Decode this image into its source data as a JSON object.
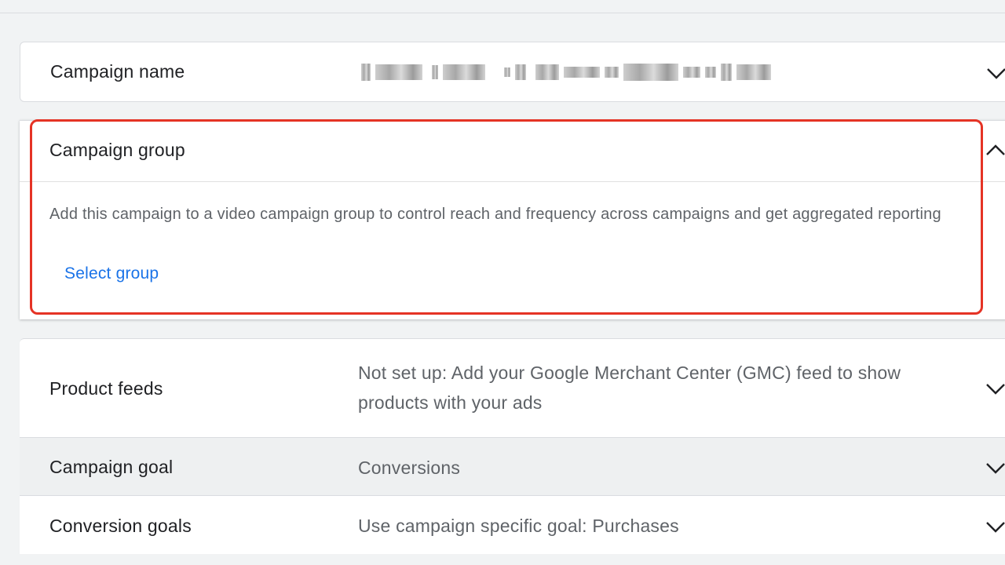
{
  "rows": {
    "campaign_name": {
      "label": "Campaign name",
      "expanded": false
    },
    "campaign_group": {
      "label": "Campaign group",
      "expanded": true,
      "description": "Add this campaign to a video campaign group to control reach and frequency across campaigns and get aggregated reporting",
      "action_label": "Select group"
    },
    "product_feeds": {
      "label": "Product feeds",
      "value": "Not set up: Add your Google Merchant Center (GMC) feed to show products with your ads",
      "expanded": false
    },
    "campaign_goal": {
      "label": "Campaign goal",
      "value": "Conversions",
      "expanded": false
    },
    "conversion_goals": {
      "label": "Conversion goals",
      "value": "Use campaign specific goal: Purchases",
      "expanded": false
    }
  },
  "icons": {
    "expand": "chevron-down-icon",
    "collapse": "chevron-up-icon"
  },
  "colors": {
    "link": "#1a73e8",
    "highlight": "#e53325",
    "label": "#202124",
    "secondary": "#5f6368",
    "hover_row": "#eef0f1"
  }
}
